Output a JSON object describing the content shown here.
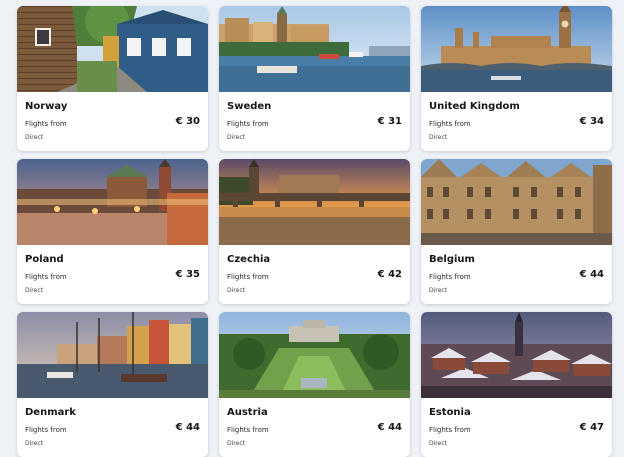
{
  "cards": [
    {
      "country": "Norway",
      "flights_label": "Flights from",
      "price": "€ 30",
      "stops": "Direct"
    },
    {
      "country": "Sweden",
      "flights_label": "Flights from",
      "price": "€ 31",
      "stops": "Direct"
    },
    {
      "country": "United Kingdom",
      "flights_label": "Flights from",
      "price": "€ 34",
      "stops": "Direct"
    },
    {
      "country": "Poland",
      "flights_label": "Flights from",
      "price": "€ 35",
      "stops": "Direct"
    },
    {
      "country": "Czechia",
      "flights_label": "Flights from",
      "price": "€ 42",
      "stops": "Direct"
    },
    {
      "country": "Belgium",
      "flights_label": "Flights from",
      "price": "€ 44",
      "stops": "Direct"
    },
    {
      "country": "Denmark",
      "flights_label": "Flights from",
      "price": "€ 44",
      "stops": "Direct"
    },
    {
      "country": "Austria",
      "flights_label": "Flights from",
      "price": "€ 44",
      "stops": "Direct"
    },
    {
      "country": "Estonia",
      "flights_label": "Flights from",
      "price": "€ 47",
      "stops": "Direct"
    }
  ]
}
